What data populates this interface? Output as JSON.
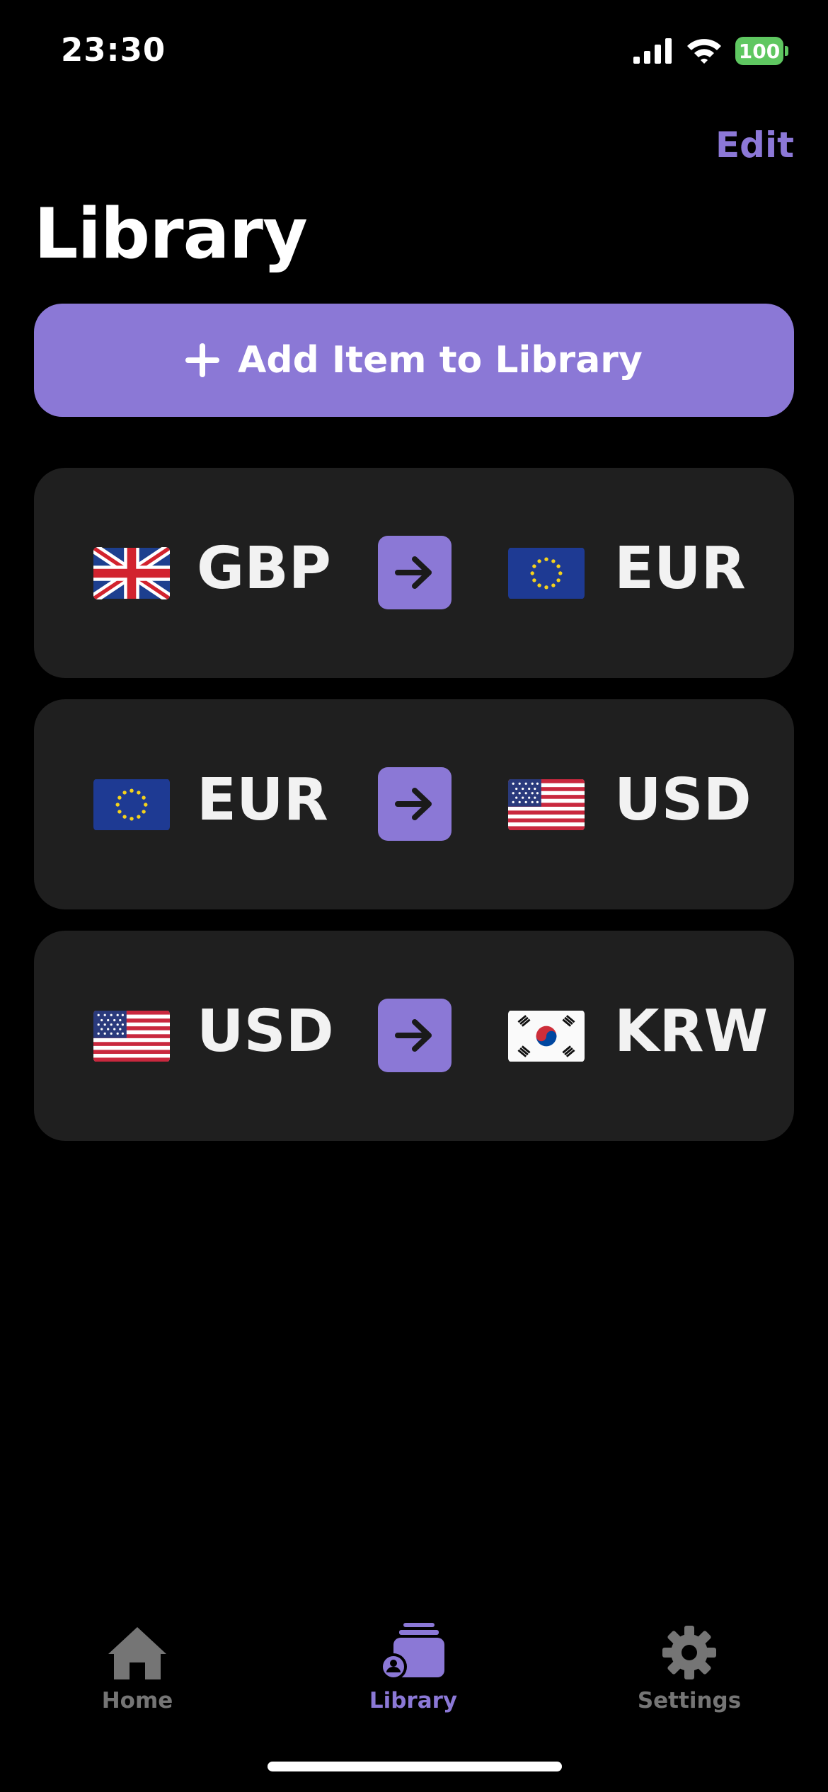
{
  "status_bar": {
    "time": "23:30",
    "battery": "100",
    "icons": [
      "cellular-signal-icon",
      "wifi-icon",
      "battery-icon"
    ]
  },
  "nav": {
    "edit_label": "Edit",
    "title": "Library"
  },
  "add_button": {
    "label": "Add Item to Library",
    "icon": "plus-icon"
  },
  "pairs": [
    {
      "from": {
        "code": "GBP",
        "flag": "uk-flag"
      },
      "to": {
        "code": "EUR",
        "flag": "eu-flag"
      }
    },
    {
      "from": {
        "code": "EUR",
        "flag": "eu-flag"
      },
      "to": {
        "code": "USD",
        "flag": "us-flag"
      }
    },
    {
      "from": {
        "code": "USD",
        "flag": "us-flag"
      },
      "to": {
        "code": "KRW",
        "flag": "kr-flag"
      }
    }
  ],
  "tab_bar": {
    "tabs": [
      {
        "label": "Home",
        "icon": "house-icon",
        "active": false
      },
      {
        "label": "Library",
        "icon": "library-icon",
        "active": true
      },
      {
        "label": "Settings",
        "icon": "gear-icon",
        "active": false
      }
    ]
  },
  "colors": {
    "accent": "#8b78d6",
    "card": "#1f1f1f",
    "background": "#000000",
    "inactive_tab": "#757575",
    "battery": "#5fc761"
  }
}
